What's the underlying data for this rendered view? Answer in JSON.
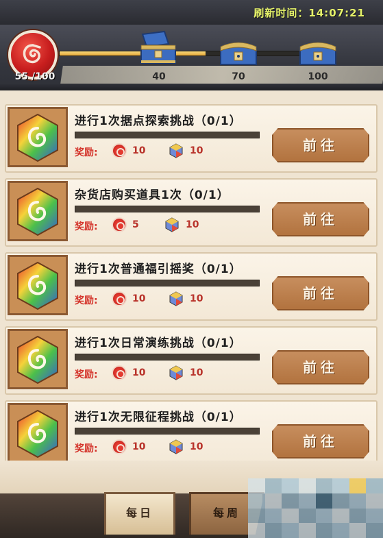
{
  "header": {
    "refresh_text": "刷新时间：14:07:21",
    "points_text": "55 /100",
    "progress_fraction": 0.55,
    "chests": [
      {
        "label": "40",
        "state": "opened"
      },
      {
        "label": "70",
        "state": "closed"
      },
      {
        "label": "100",
        "state": "closed"
      }
    ]
  },
  "tasks": [
    {
      "title": "进行1次据点探索挑战（0/1）",
      "reward_label": "奖励:",
      "coin_amount": "10",
      "gem_amount": "10",
      "button_label": "前往",
      "progress_fraction": 0
    },
    {
      "title": "杂货店购买道具1次（0/1）",
      "reward_label": "奖励:",
      "coin_amount": "5",
      "gem_amount": "10",
      "button_label": "前往",
      "progress_fraction": 0
    },
    {
      "title": "进行1次普通福引摇奖（0/1）",
      "reward_label": "奖励:",
      "coin_amount": "10",
      "gem_amount": "10",
      "button_label": "前往",
      "progress_fraction": 0
    },
    {
      "title": "进行1次日常演练挑战（0/1）",
      "reward_label": "奖励:",
      "coin_amount": "10",
      "gem_amount": "10",
      "button_label": "前往",
      "progress_fraction": 0
    },
    {
      "title": "进行1次无限征程挑战（0/1）",
      "reward_label": "奖励:",
      "coin_amount": "10",
      "gem_amount": "10",
      "button_label": "前往",
      "progress_fraction": 0
    }
  ],
  "tabs": {
    "daily": "每日",
    "weekly": "每周",
    "selected": "daily"
  },
  "colors": {
    "accent_red": "#d4342b",
    "button": "#b97a45",
    "refresh_text": "#e6f36a"
  }
}
